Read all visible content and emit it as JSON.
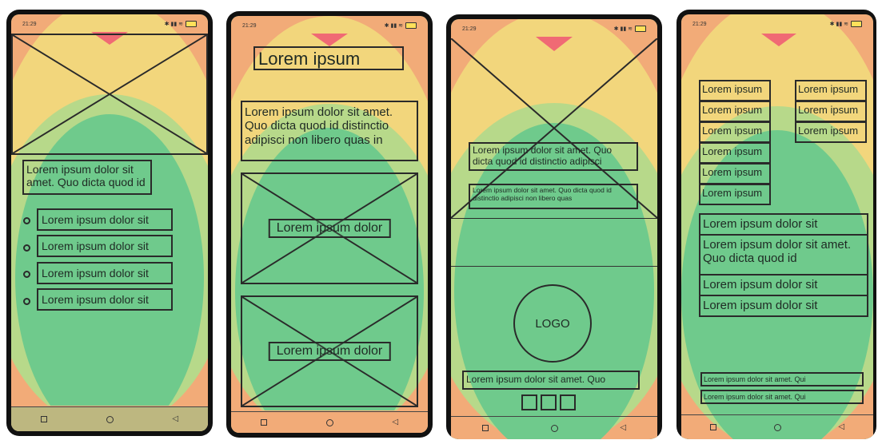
{
  "statusbar": {
    "time": "21:29",
    "left_icons": "↻ ⏰ ◀ ♥ ⋯",
    "right_icons": "✱ ▮▮ ≋"
  },
  "phone1": {
    "paragraph": "Lorem ipsum dolor sit amet. Quo dicta quod id",
    "list": [
      "Lorem ipsum dolor sit",
      "Lorem ipsum dolor sit",
      "Lorem ipsum dolor sit",
      "Lorem ipsum dolor sit"
    ]
  },
  "phone2": {
    "title": "Lorem ipsum",
    "paragraph": "Lorem ipsum dolor sit amet. Quo dicta quod id distinctio adipisci non libero quas in",
    "card1_label": "Lorem ipsum dolor",
    "card2_label": "Lorem ipsum dolor"
  },
  "phone3": {
    "text1": "Lorem ipsum dolor sit amet. Quo dicta quod id distinctio adipisci",
    "text2": "Lorem ipsum dolor sit amet. Quo dicta quod id distinctio adipisci non libero quas",
    "logo": "LOGO",
    "footer_text": "Lorem ipsum dolor sit amet. Quo"
  },
  "phone4": {
    "left_tags": [
      "Lorem ipsum",
      "Lorem ipsum",
      "Lorem ipsum",
      "Lorem ipsum",
      "Lorem ipsum",
      "Lorem ipsum"
    ],
    "right_tags": [
      "Lorem ipsum",
      "Lorem ipsum",
      "Lorem ipsum"
    ],
    "row1": "Lorem ipsum dolor sit",
    "row2": "Lorem ipsum dolor sit amet. Quo dicta quod id",
    "row3": "Lorem ipsum dolor sit",
    "row4": "Lorem ipsum dolor sit",
    "footer1": "Lorem ipsum dolor sit amet. Qui",
    "footer2": "Lorem ipsum dolor sit amet. Qui"
  },
  "colors": {
    "heat_green": "#6fca8c",
    "heat_yellow": "#f2d67c",
    "heat_orange": "#f2ab78",
    "heat_red": "#f06a74"
  }
}
